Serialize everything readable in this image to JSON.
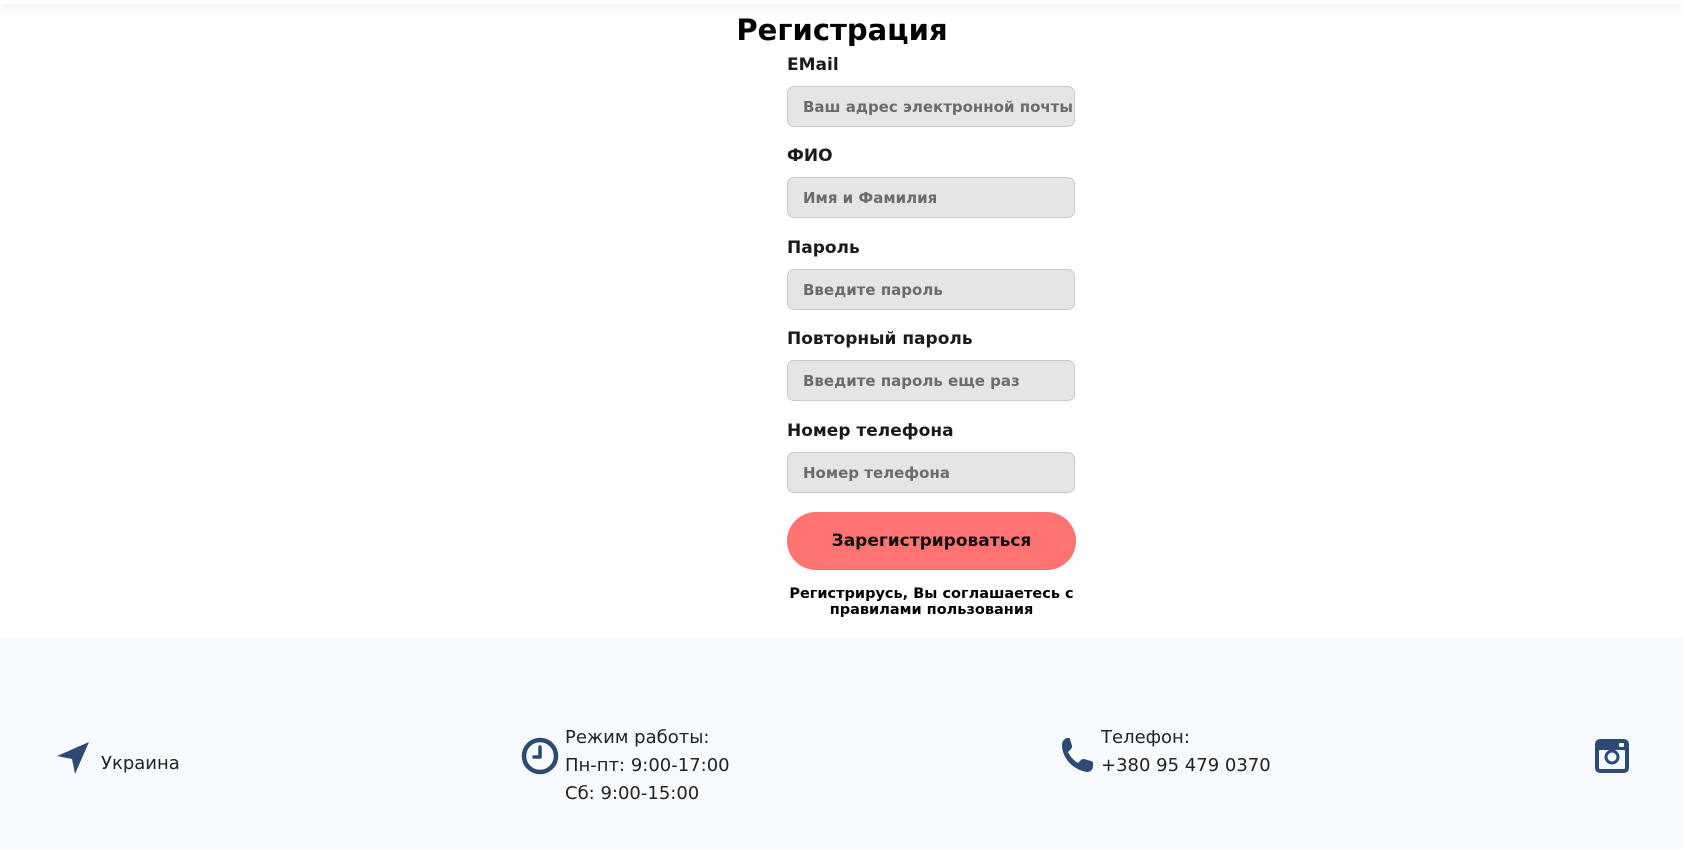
{
  "registration": {
    "title": "Регистрация",
    "fields": [
      {
        "label": "EMail",
        "placeholder": "Ваш адрес электронной почты",
        "value": ""
      },
      {
        "label": "ФИО",
        "placeholder": "Имя и Фамилия",
        "value": ""
      },
      {
        "label": "Пароль",
        "placeholder": "Введите пароль",
        "value": ""
      },
      {
        "label": "Повторный пароль",
        "placeholder": "Введите пароль еще раз",
        "value": ""
      },
      {
        "label": "Номер телефона",
        "placeholder": "Номер телефона",
        "value": ""
      }
    ],
    "submit_label": "Зарегистрироваться",
    "terms_line1": "Регистрирусь, Вы соглашаетесь с",
    "terms_line2": "правилами пользования"
  },
  "footer": {
    "location": {
      "icon": "location-arrow-icon",
      "text": "Украина"
    },
    "hours": {
      "icon": "clock-icon",
      "title": "Режим работы:",
      "line1": "Пн-пт: 9:00-17:00",
      "line2": "Сб: 9:00-15:00"
    },
    "phone": {
      "icon": "phone-icon",
      "title": "Телефон:",
      "number": "+380 95 479 0370"
    },
    "social": {
      "icon": "instagram-icon"
    }
  },
  "colors": {
    "accent_button": "#ff7373",
    "icon_color": "#2c4a73",
    "footer_bg": "#f7fafc",
    "input_bg": "#e5e5e5"
  }
}
